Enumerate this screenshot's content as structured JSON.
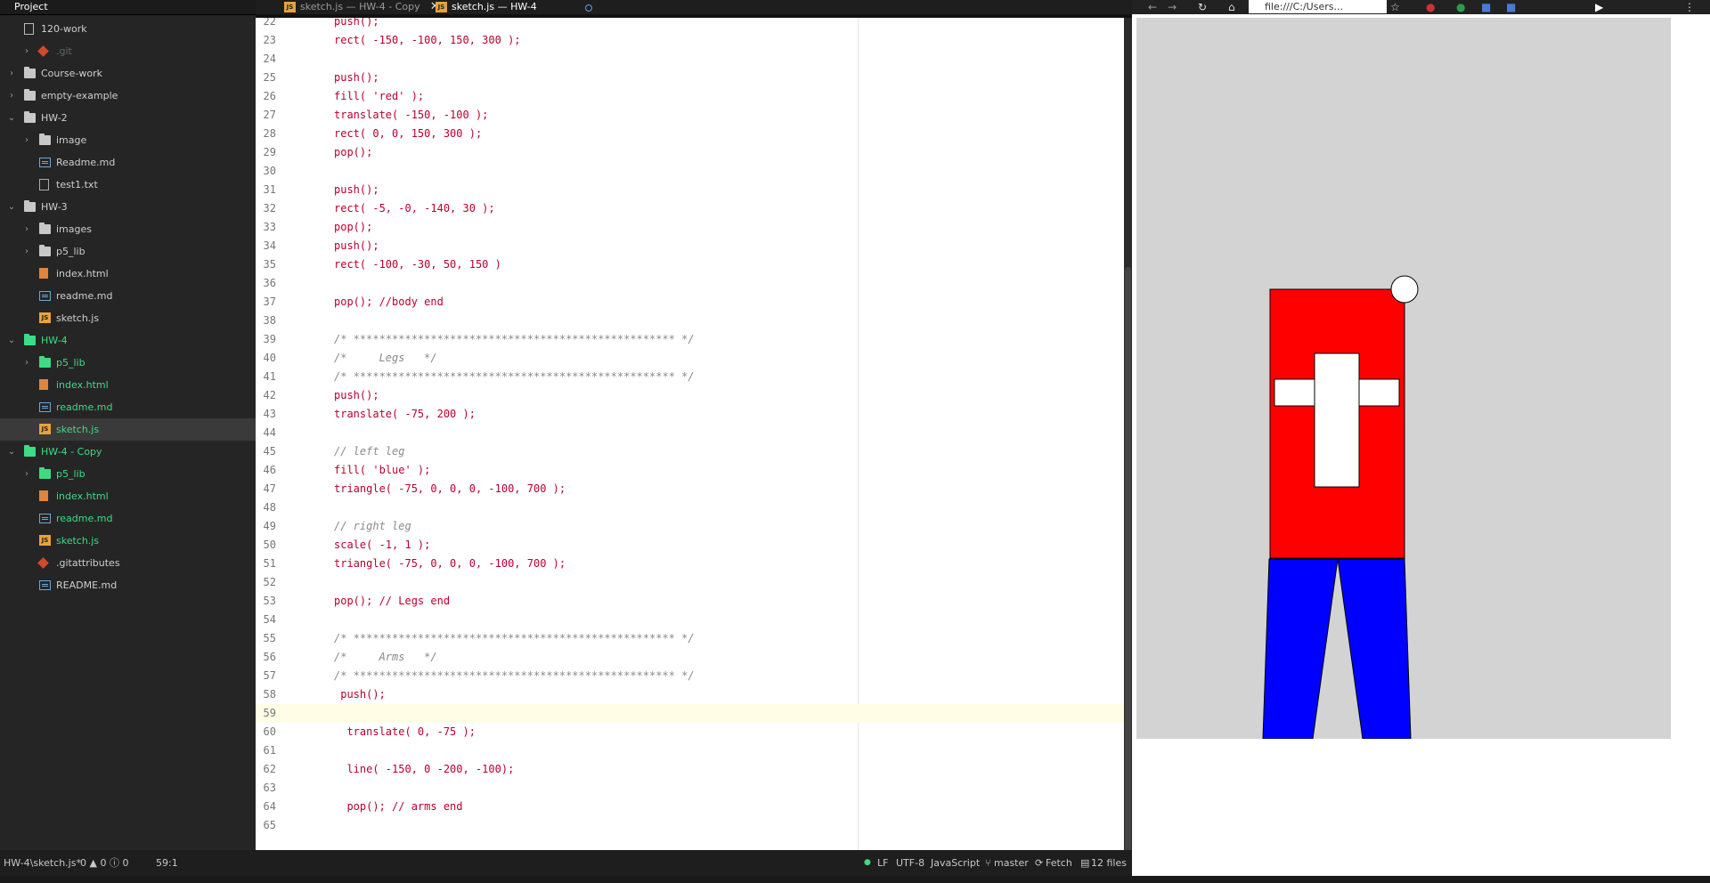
{
  "project": {
    "header": "Project",
    "tree": [
      {
        "label": "120-work",
        "type": "repo",
        "depth": 0,
        "chev": ""
      },
      {
        "label": ".git",
        "type": "git",
        "depth": 1,
        "chev": "›",
        "dim": true
      },
      {
        "label": "Course-work",
        "type": "folder",
        "depth": 0,
        "chev": "›"
      },
      {
        "label": "empty-example",
        "type": "folder",
        "depth": 0,
        "chev": "›"
      },
      {
        "label": "HW-2",
        "type": "folder",
        "depth": 0,
        "chev": "⌄"
      },
      {
        "label": "image",
        "type": "folder",
        "depth": 1,
        "chev": "›"
      },
      {
        "label": "Readme.md",
        "type": "md",
        "depth": 1,
        "chev": ""
      },
      {
        "label": "test1.txt",
        "type": "txt",
        "depth": 1,
        "chev": ""
      },
      {
        "label": "HW-3",
        "type": "folder",
        "depth": 0,
        "chev": "⌄"
      },
      {
        "label": "images",
        "type": "folder",
        "depth": 1,
        "chev": "›"
      },
      {
        "label": "p5_lib",
        "type": "folder",
        "depth": 1,
        "chev": "›"
      },
      {
        "label": "index.html",
        "type": "html",
        "depth": 1,
        "chev": ""
      },
      {
        "label": "readme.md",
        "type": "md",
        "depth": 1,
        "chev": ""
      },
      {
        "label": "sketch.js",
        "type": "js",
        "depth": 1,
        "chev": ""
      },
      {
        "label": "HW-4",
        "type": "folder",
        "depth": 0,
        "chev": "⌄",
        "git": true
      },
      {
        "label": "p5_lib",
        "type": "folder",
        "depth": 1,
        "chev": "›",
        "git": true
      },
      {
        "label": "index.html",
        "type": "html",
        "depth": 1,
        "chev": "",
        "git": true
      },
      {
        "label": "readme.md",
        "type": "md",
        "depth": 1,
        "chev": "",
        "git": true
      },
      {
        "label": "sketch.js",
        "type": "js",
        "depth": 1,
        "chev": "",
        "git": true,
        "selected": true
      },
      {
        "label": "HW-4 - Copy",
        "type": "folder",
        "depth": 0,
        "chev": "⌄",
        "git": true
      },
      {
        "label": "p5_lib",
        "type": "folder",
        "depth": 1,
        "chev": "›",
        "git": true
      },
      {
        "label": "index.html",
        "type": "html",
        "depth": 1,
        "chev": "",
        "git": true
      },
      {
        "label": "readme.md",
        "type": "md",
        "depth": 1,
        "chev": "",
        "git": true
      },
      {
        "label": "sketch.js",
        "type": "js",
        "depth": 1,
        "chev": "",
        "git": true
      },
      {
        "label": ".gitattributes",
        "type": "git",
        "depth": 1,
        "chev": ""
      },
      {
        "label": "README.md",
        "type": "md",
        "depth": 1,
        "chev": ""
      }
    ]
  },
  "tabs": [
    {
      "label": "sketch.js — HW-4 - Copy",
      "active": false
    },
    {
      "label": "sketch.js — HW-4",
      "active": true
    }
  ],
  "editor": {
    "current_line": 59,
    "lines": [
      {
        "n": "22",
        "code": "push();"
      },
      {
        "n": "23",
        "code": "rect( -150, -100, 150, 300 );"
      },
      {
        "n": "24",
        "code": ""
      },
      {
        "n": "25",
        "code": "push();"
      },
      {
        "n": "26",
        "code": "fill( 'red' );"
      },
      {
        "n": "27",
        "code": "translate( -150, -100 );"
      },
      {
        "n": "28",
        "code": "rect( 0, 0, 150, 300 );"
      },
      {
        "n": "29",
        "code": "pop();"
      },
      {
        "n": "30",
        "code": ""
      },
      {
        "n": "31",
        "code": "push();"
      },
      {
        "n": "32",
        "code": "rect( -5, -0, -140, 30 );"
      },
      {
        "n": "33",
        "code": "pop();"
      },
      {
        "n": "34",
        "code": "push();"
      },
      {
        "n": "35",
        "code": "rect( -100, -30, 50, 150 )"
      },
      {
        "n": "36",
        "code": ""
      },
      {
        "n": "37",
        "code": "pop(); //body end"
      },
      {
        "n": "38",
        "code": ""
      },
      {
        "n": "39",
        "code": "/* ************************************************** */"
      },
      {
        "n": "40",
        "code": "/*     Legs   */"
      },
      {
        "n": "41",
        "code": "/* ************************************************** */"
      },
      {
        "n": "42",
        "code": "push();"
      },
      {
        "n": "43",
        "code": "translate( -75, 200 );"
      },
      {
        "n": "44",
        "code": ""
      },
      {
        "n": "45",
        "code": "// left leg"
      },
      {
        "n": "46",
        "code": "fill( 'blue' );"
      },
      {
        "n": "47",
        "code": "triangle( -75, 0, 0, 0, -100, 700 );"
      },
      {
        "n": "48",
        "code": ""
      },
      {
        "n": "49",
        "code": "// right leg"
      },
      {
        "n": "50",
        "code": "scale( -1, 1 );"
      },
      {
        "n": "51",
        "code": "triangle( -75, 0, 0, 0, -100, 700 );"
      },
      {
        "n": "52",
        "code": ""
      },
      {
        "n": "53",
        "code": "pop(); // Legs end"
      },
      {
        "n": "54",
        "code": ""
      },
      {
        "n": "55",
        "code": "/* ************************************************** */"
      },
      {
        "n": "56",
        "code": "/*     Arms   */"
      },
      {
        "n": "57",
        "code": "/* ************************************************** */"
      },
      {
        "n": "58",
        "code": " push();"
      },
      {
        "n": "59",
        "code": ""
      },
      {
        "n": "60",
        "code": "  translate( 0, -75 );"
      },
      {
        "n": "61",
        "code": ""
      },
      {
        "n": "62",
        "code": "  line( -150, 0 -200, -100);"
      },
      {
        "n": "63",
        "code": ""
      },
      {
        "n": "64",
        "code": "  pop(); // arms end"
      },
      {
        "n": "65",
        "code": ""
      }
    ]
  },
  "status": {
    "path": "HW-4\\sketch.js*",
    "problems": "0 ▲ 0 ⓘ 0",
    "cursor": "59:1",
    "eol": "LF",
    "encoding": "UTF-8",
    "grammar": "JavaScript",
    "branch": "master",
    "fetch": "Fetch",
    "files": "12 files"
  },
  "browser": {
    "url": "file:///C:/Users..."
  },
  "colors": {
    "torso": "#ff0000",
    "legs": "#0000ff",
    "canvas_bg": "#d3d3d3",
    "git_green": "#3ddc84"
  }
}
